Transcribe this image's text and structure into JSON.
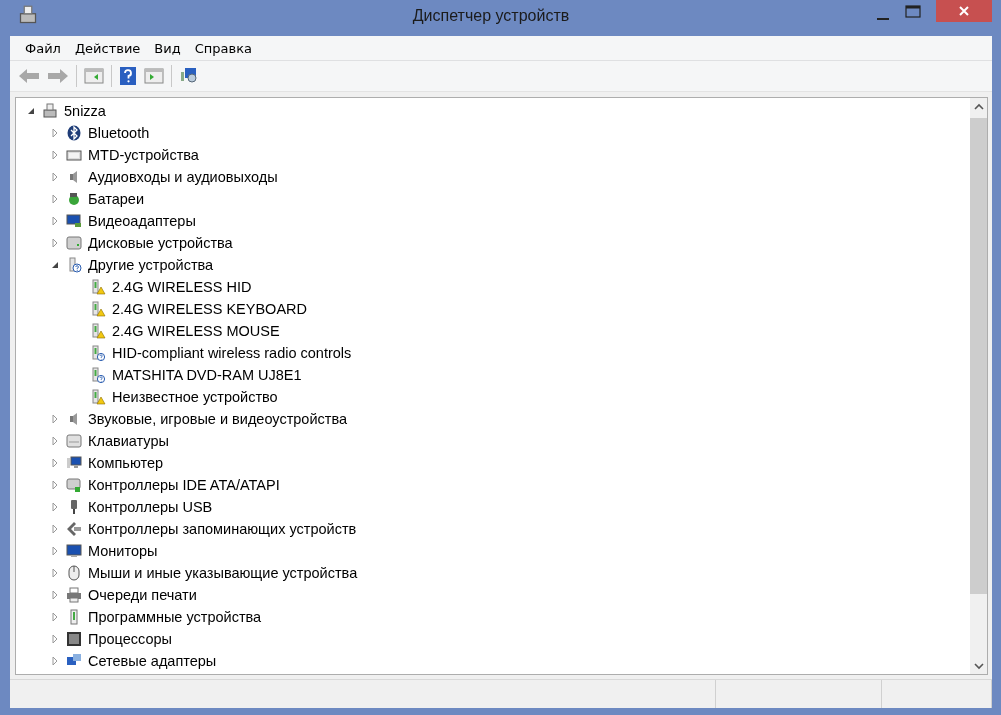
{
  "window": {
    "title": "Диспетчер устройств"
  },
  "menu": [
    "Файл",
    "Действие",
    "Вид",
    "Справка"
  ],
  "tree": {
    "label": "5nizza",
    "expanded": true,
    "children": [
      {
        "label": "Bluetooth",
        "expanded": false
      },
      {
        "label": "MTD-устройства",
        "expanded": false
      },
      {
        "label": "Аудиовходы и аудиовыходы",
        "expanded": false
      },
      {
        "label": "Батареи",
        "expanded": false
      },
      {
        "label": "Видеоадаптеры",
        "expanded": false
      },
      {
        "label": "Дисковые устройства",
        "expanded": false
      },
      {
        "label": "Другие устройства",
        "expanded": true,
        "children": [
          {
            "label": "2.4G WIRELESS HID",
            "kind": "warning"
          },
          {
            "label": "2.4G WIRELESS KEYBOARD",
            "kind": "warning"
          },
          {
            "label": "2.4G WIRELESS MOUSE",
            "kind": "warning"
          },
          {
            "label": "HID-compliant wireless radio controls",
            "kind": "unknown"
          },
          {
            "label": "MATSHITA DVD-RAM UJ8E1",
            "kind": "unknown"
          },
          {
            "label": "Неизвестное устройство",
            "kind": "warning"
          }
        ]
      },
      {
        "label": "Звуковые, игровые и видеоустройства",
        "expanded": false
      },
      {
        "label": "Клавиатуры",
        "expanded": false
      },
      {
        "label": "Компьютер",
        "expanded": false
      },
      {
        "label": "Контроллеры IDE ATA/ATAPI",
        "expanded": false
      },
      {
        "label": "Контроллеры USB",
        "expanded": false
      },
      {
        "label": "Контроллеры запоминающих устройств",
        "expanded": false
      },
      {
        "label": "Мониторы",
        "expanded": false
      },
      {
        "label": "Мыши и иные указывающие устройства",
        "expanded": false
      },
      {
        "label": "Очереди печати",
        "expanded": false
      },
      {
        "label": "Программные устройства",
        "expanded": false
      },
      {
        "label": "Процессоры",
        "expanded": false
      },
      {
        "label": "Сетевые адаптеры",
        "expanded": false
      }
    ]
  }
}
